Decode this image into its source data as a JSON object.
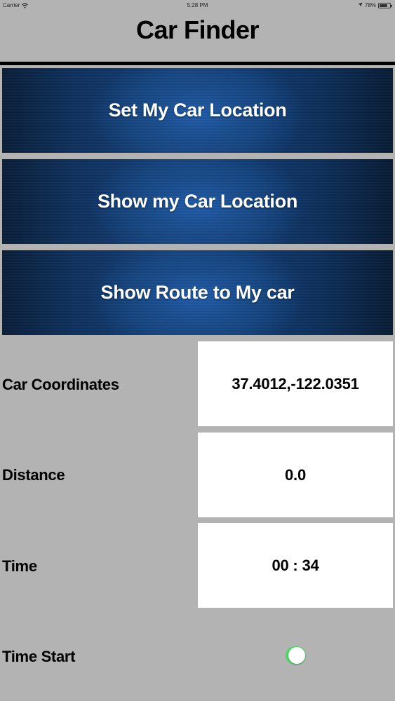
{
  "status_bar": {
    "carrier": "Carrier",
    "time": "5:28 PM",
    "battery": "78%",
    "battery_level": 0.78,
    "icons": [
      "wifi-icon",
      "location-arrow-icon",
      "battery-icon"
    ]
  },
  "header": {
    "title": "Car Finder"
  },
  "buttons": {
    "set_location": "Set My Car Location",
    "show_location": "Show my Car Location",
    "show_route": "Show Route to My car"
  },
  "info": {
    "coordinates_label": "Car Coordinates",
    "coordinates_value": "37.4012,-122.0351",
    "distance_label": "Distance",
    "distance_value": "0.0",
    "time_label": "Time",
    "time_value": "00 : 34",
    "time_start_label": "Time Start",
    "time_start_on": true
  },
  "colors": {
    "background": "#b3b3b3",
    "button_blue": "#123f78",
    "toggle_on": "#4cd964"
  }
}
